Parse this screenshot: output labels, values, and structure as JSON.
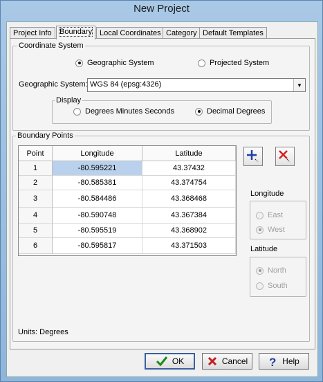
{
  "window": {
    "title": "New Project"
  },
  "tabs": [
    "Project Info",
    "Boundary",
    "Local Coordinates",
    "Category",
    "Default Templates"
  ],
  "coordinate_system": {
    "legend": "Coordinate System",
    "geographic_label": "Geographic System",
    "projected_label": "Projected System",
    "selected": "geographic",
    "geo_system_label": "Geographic System:",
    "geo_system_value": "WGS 84 (epsg:4326)",
    "display": {
      "legend": "Display",
      "dms_label": "Degrees Minutes Seconds",
      "dd_label": "Decimal Degrees",
      "selected": "decimal_degrees"
    }
  },
  "boundary_points": {
    "legend": "Boundary Points",
    "columns": [
      "Point",
      "Longitude",
      "Latitude"
    ],
    "rows": [
      {
        "point": "1",
        "longitude": "-80.595221",
        "latitude": "43.37432"
      },
      {
        "point": "2",
        "longitude": "-80.585381",
        "latitude": "43.374754"
      },
      {
        "point": "3",
        "longitude": "-80.584486",
        "latitude": "43.368468"
      },
      {
        "point": "4",
        "longitude": "-80.590748",
        "latitude": "43.367384"
      },
      {
        "point": "5",
        "longitude": "-80.595519",
        "latitude": "43.368902"
      },
      {
        "point": "6",
        "longitude": "-80.595817",
        "latitude": "43.371503"
      }
    ],
    "longitude_group": {
      "legend": "Longitude",
      "east": "East",
      "west": "West",
      "selected": "west"
    },
    "latitude_group": {
      "legend": "Latitude",
      "north": "North",
      "south": "South",
      "selected": "north"
    },
    "units": "Units: Degrees"
  },
  "buttons": {
    "ok": "OK",
    "cancel": "Cancel",
    "help": "Help"
  }
}
